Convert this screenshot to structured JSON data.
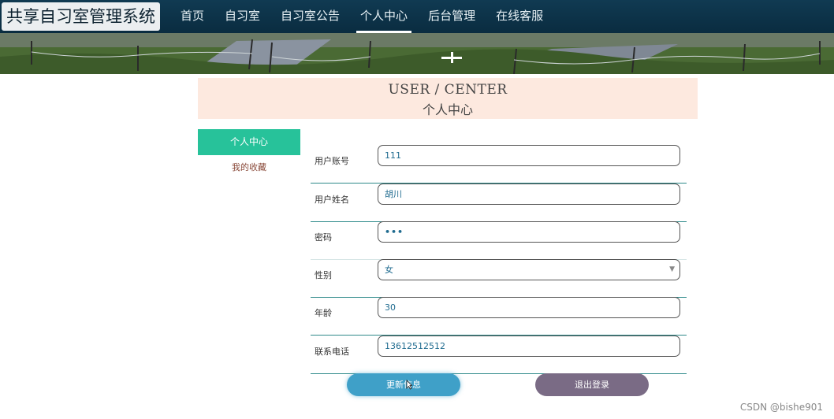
{
  "site": {
    "title": "共享自习室管理系统"
  },
  "nav": {
    "items": [
      {
        "label": "首页"
      },
      {
        "label": "自习室"
      },
      {
        "label": "自习室公告"
      },
      {
        "label": "个人中心",
        "active": true
      },
      {
        "label": "后台管理"
      },
      {
        "label": "在线客服"
      }
    ]
  },
  "header": {
    "en": "USER / CENTER",
    "cn": "个人中心"
  },
  "sidebar": {
    "items": [
      {
        "label": "个人中心",
        "active": true
      },
      {
        "label": "我的收藏"
      }
    ]
  },
  "form": {
    "fields": [
      {
        "label": "用户账号",
        "value": "111"
      },
      {
        "label": "用户姓名",
        "value": "胡川"
      },
      {
        "label": "密码",
        "value": "•••"
      },
      {
        "label": "性别",
        "value": "女"
      },
      {
        "label": "年龄",
        "value": "30"
      },
      {
        "label": "联系电话",
        "value": "13612512512"
      }
    ]
  },
  "buttons": {
    "update": "更新信息",
    "logout": "退出登录"
  },
  "watermark": "CSDN @bishe901",
  "colors": {
    "nav_bg": "#0a2c40",
    "accent": "#27c29a",
    "update_btn": "#3fa0c8",
    "logout_btn": "#7a6b85",
    "header_bg": "#fde9df"
  }
}
